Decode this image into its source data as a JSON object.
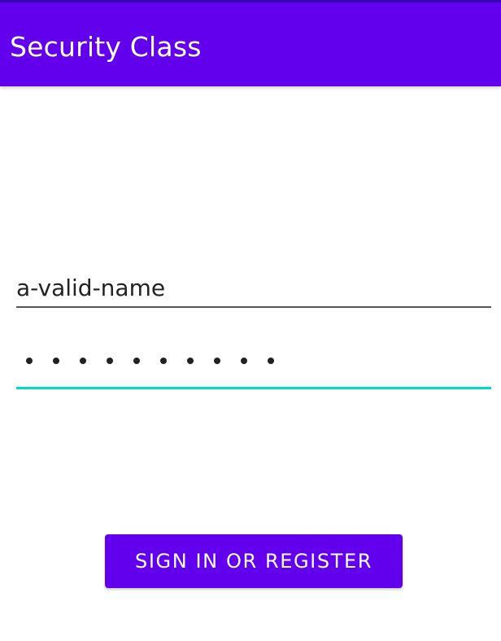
{
  "app_bar": {
    "title": "Security Class",
    "background_color": "#6200EE"
  },
  "form": {
    "username": {
      "value": "a-valid-name"
    },
    "password": {
      "masked_length": 10,
      "focused_underline_color": "#03DAC5"
    }
  },
  "primary_button": {
    "label": "SIGN IN OR REGISTER",
    "background_color": "#6200EE"
  }
}
